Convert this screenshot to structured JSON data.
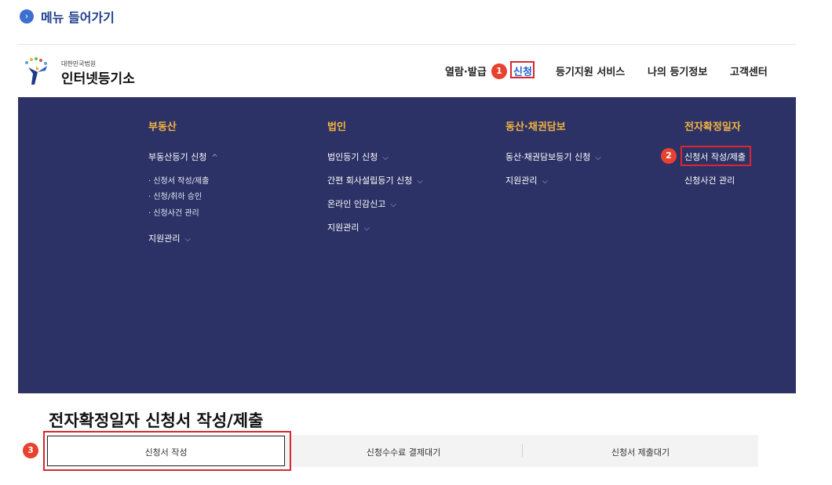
{
  "section": {
    "icon": "chevron-right-circle-icon",
    "title": "메뉴 들어가기"
  },
  "logo": {
    "subtitle": "대한민국법원",
    "title": "인터넷등기소"
  },
  "nav": {
    "items": [
      {
        "label": "열람·발급"
      },
      {
        "label": "신청",
        "active": true
      },
      {
        "label": "등기지원 서비스"
      },
      {
        "label": "나의 등기정보"
      },
      {
        "label": "고객센터"
      }
    ]
  },
  "badges": [
    "1",
    "2",
    "3"
  ],
  "menu": {
    "columns": [
      {
        "category": "부동산",
        "items": [
          {
            "label": "부동산등기 신청",
            "chevron": "^",
            "subitems": [
              "· 신청서 작성/제출",
              "· 신청/취하 승인",
              "· 신청사건 관리"
            ]
          },
          {
            "label": "지원관리",
            "chevron": "⌵"
          }
        ]
      },
      {
        "category": "법인",
        "items": [
          {
            "label": "법인등기 신청",
            "chevron": "⌵"
          },
          {
            "label": "간편 회사설립등기 신청",
            "chevron": "⌵"
          },
          {
            "label": "온라인 인감신고",
            "chevron": "⌵"
          },
          {
            "label": "지원관리",
            "chevron": "⌵"
          }
        ]
      },
      {
        "category": "동산·채권담보",
        "items": [
          {
            "label": "동산·채권담보등기 신청",
            "chevron": "⌵"
          },
          {
            "label": "지원관리",
            "chevron": "⌵"
          }
        ]
      },
      {
        "category": "전자확정일자",
        "items": [
          {
            "label": "신청서 작성/제출"
          },
          {
            "label": "신청사건 관리"
          }
        ]
      }
    ]
  },
  "page": {
    "title": "전자확정일자 신청서 작성/제출",
    "tabs": [
      {
        "label": "신청서 작성",
        "active": true
      },
      {
        "label": "신청수수료 결제대기"
      },
      {
        "label": "신청서 제출대기"
      }
    ]
  },
  "colors": {
    "panel": "#2d3266",
    "category": "#f3b43f",
    "highlight": "#d8282f",
    "badge": "#e8412f",
    "active_nav": "#1f5fd4"
  }
}
